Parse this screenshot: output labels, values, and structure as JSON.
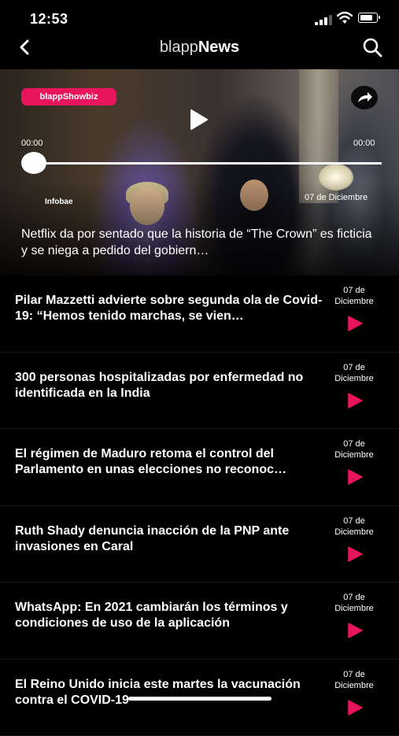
{
  "status_bar": {
    "time": "12:53"
  },
  "nav": {
    "brand_light": "blapp",
    "brand_bold": "News"
  },
  "hero": {
    "badge": "blappShowbiz",
    "time_current": "00:00",
    "time_total": "00:00",
    "progress": 0,
    "source": "Infobae",
    "date": "07 de Diciembre",
    "title": "Netflix da por sentado que la historia de “The Crown” es ficticia y se niega a pedido del gobiern…"
  },
  "news": [
    {
      "title": "Pilar Mazzetti advierte sobre segunda ola de Covid-19: “Hemos tenido marchas, se vien…",
      "date_day": "07 de",
      "date_month": "Diciembre"
    },
    {
      "title": "300 personas hospitalizadas por enfermedad no identificada en la India",
      "date_day": "07 de",
      "date_month": "Diciembre"
    },
    {
      "title": "El régimen de Maduro retoma el control del Parlamento en unas elecciones no reconoc…",
      "date_day": "07 de",
      "date_month": "Diciembre"
    },
    {
      "title": "Ruth Shady denuncia inacción de la PNP ante invasiones en Caral",
      "date_day": "07 de",
      "date_month": "Diciembre"
    },
    {
      "title": "WhatsApp: En 2021 cambiarán los términos y condiciones de uso de la aplicación",
      "date_day": "07 de",
      "date_month": "Diciembre"
    },
    {
      "title": "El Reino Unido inicia este martes la vacunación contra el COVID-19",
      "date_day": "07 de",
      "date_month": "Diciembre"
    }
  ],
  "colors": {
    "accent": "#e8145c",
    "background": "#000000"
  }
}
